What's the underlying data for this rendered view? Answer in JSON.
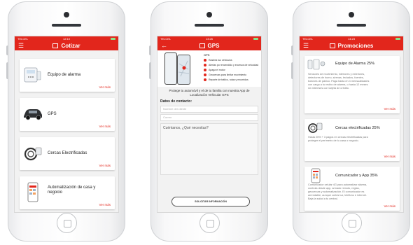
{
  "colors": {
    "accent": "#e2261c",
    "link": "#e2261c"
  },
  "screens": {
    "cotizar": {
      "status": {
        "carrier": "TELCEL",
        "time": "12:10"
      },
      "title": "Cotizar",
      "menu_icon": "hamburger-icon",
      "items": [
        {
          "label": "Equipo de alarma",
          "more": "Ver más",
          "icon": "alarm-panel-icon"
        },
        {
          "label": "GPS",
          "more": "Ver más",
          "icon": "car-icon"
        },
        {
          "label": "Cercas Electrificadas",
          "more": "Ver más",
          "icon": "fence-coil-icon"
        },
        {
          "label": "Automatización de casa y negocio",
          "more": "Ver más",
          "icon": "smart-home-phone-icon"
        }
      ]
    },
    "gps": {
      "status": {
        "carrier": "TELCEL",
        "time": "13:26"
      },
      "title": "GPS",
      "back_icon": "back-arrow-icon",
      "features_title": "GPS",
      "features": [
        "Rastrea tus vehículos",
        "Alertas por encendido y excesos de velocidad",
        "Apaga el motor",
        "Geocercas para limitar movimiento",
        "Reporte de tráfico, rutas y recorridos"
      ],
      "intro": "Protege tu automóvil y el de tu familia con nuestra App de Localización Vehicular GPS",
      "contact_heading": "Datos de contacto:",
      "name_placeholder": "Nombre del cliente",
      "phone_placeholder": "Correo",
      "message_placeholder": "Cuéntanos, ¿Qué necesitas?",
      "submit_label": "SOLICITAR INFORMACIÓN"
    },
    "promociones": {
      "status": {
        "carrier": "TELCEL",
        "time": "14:23"
      },
      "title": "Promociones",
      "menu_icon": "hamburger-icon",
      "promos": [
        {
          "label": "Equipo de Alarma 25%",
          "desc": "Sensores de movimiento, interiores y exteriores, detectores de humo, sirenas, teclados, fuentes, botones de pánico. Paga hasta en 4 mensualidades con cargo a tu recibo de alarma, o hasta 12 meses sin intereses con tarjeta de crédito.",
          "more": "Ver más",
          "icon": "alarm-sensors-icon"
        },
        {
          "label": "Cercas electrificadas 25%",
          "desc": "Hasta 25% + 3 pagos en cercas electrificadas para proteger el perímetro de tu casa o negocio.",
          "more": "Ver más",
          "icon": "fence-coil-icon"
        },
        {
          "label": "Comunicador y App 35%",
          "desc": "Comunicador celular 4G para automatizar alarma, controla desde app, armado remoto, reglas, geocercas y automatización. El comunicador es arrendable, aunque cortes luz, teléfono e internet. Baja la salud a tu central.",
          "more": "Ver más",
          "icon": "communicator-app-icon"
        }
      ]
    }
  }
}
